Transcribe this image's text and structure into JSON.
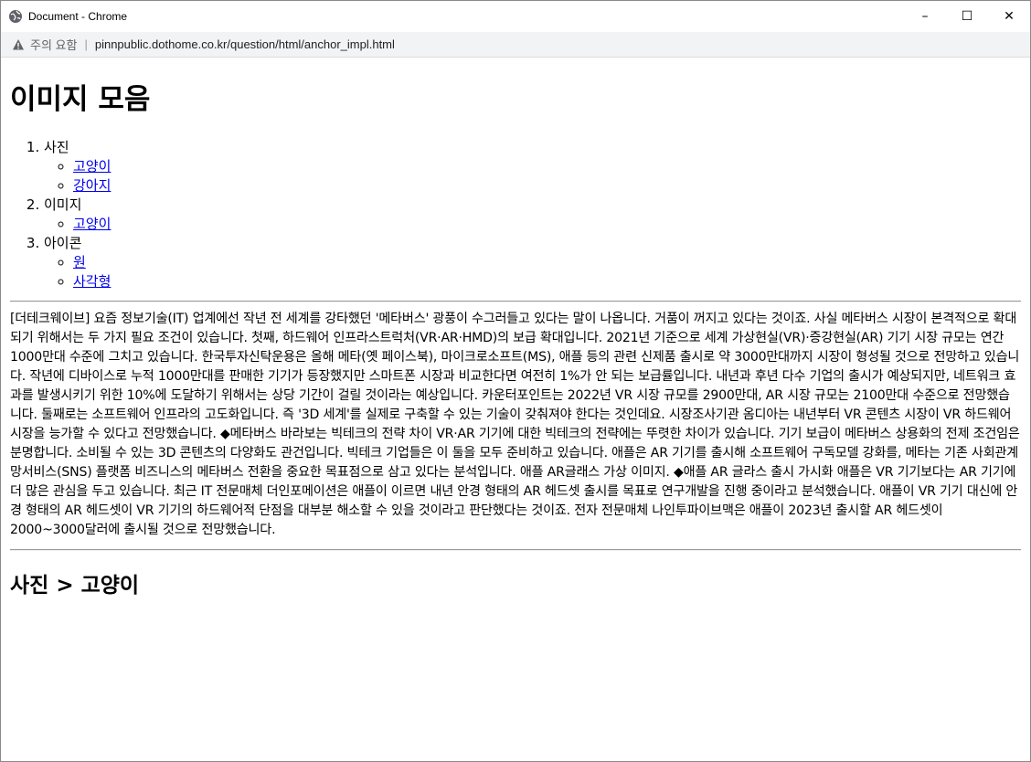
{
  "window": {
    "title": "Document - Chrome",
    "minimize_glyph": "–",
    "maximize_glyph": "☐",
    "close_glyph": "✕"
  },
  "addressbar": {
    "warning_text": "주의 요함",
    "separator": "|",
    "url": "pinnpublic.dothome.co.kr/question/html/anchor_impl.html"
  },
  "page": {
    "heading": "이미지 모음",
    "toc": [
      {
        "label": "사진",
        "links": [
          "고양이",
          "강아지"
        ]
      },
      {
        "label": "이미지",
        "links": [
          "고양이"
        ]
      },
      {
        "label": "아이콘",
        "links": [
          "원",
          "사각형"
        ]
      }
    ],
    "article": "[더테크웨이브] 요즘 정보기술(IT) 업계에선 작년 전 세계를 강타했던 '메타버스' 광풍이 수그러들고 있다는 말이 나옵니다. 거품이 꺼지고 있다는 것이죠. 사실 메타버스 시장이 본격적으로 확대되기 위해서는 두 가지 필요 조건이 있습니다. 첫째, 하드웨어 인프라스트럭처(VR·AR·HMD)의 보급 확대입니다. 2021년 기준으로 세계 가상현실(VR)·증강현실(AR) 기기 시장 규모는 연간 1000만대 수준에 그치고 있습니다. 한국투자신탁운용은 올해 메타(옛 페이스북), 마이크로소프트(MS), 애플 등의 관련 신제품 출시로 약 3000만대까지 시장이 형성될 것으로 전망하고 있습니다. 작년에 디바이스로 누적 1000만대를 판매한 기기가 등장했지만 스마트폰 시장과 비교한다면 여전히 1%가 안 되는 보급률입니다. 내년과 후년 다수 기업의 출시가 예상되지만, 네트워크 효과를 발생시키기 위한 10%에 도달하기 위해서는 상당 기간이 걸릴 것이라는 예상입니다. 카운터포인트는 2022년 VR 시장 규모를 2900만대, AR 시장 규모는 2100만대 수준으로 전망했습니다. 둘째로는 소프트웨어 인프라의 고도화입니다. 즉 '3D 세계'를 실제로 구축할 수 있는 기술이 갖춰져야 한다는 것인데요. 시장조사기관 옴디아는 내년부터 VR 콘텐츠 시장이 VR 하드웨어 시장을 능가할 수 있다고 전망했습니다. ◆메타버스 바라보는 빅테크의 전략 차이 VR·AR 기기에 대한 빅테크의 전략에는 뚜렷한 차이가 있습니다. 기기 보급이 메타버스 상용화의 전제 조건임은 분명합니다. 소비될 수 있는 3D 콘텐츠의 다양화도 관건입니다. 빅테크 기업들은 이 둘을 모두 준비하고 있습니다. 애플은 AR 기기를 출시해 소프트웨어 구독모델 강화를, 메타는 기존 사회관계망서비스(SNS) 플랫폼 비즈니스의 메타버스 전환을 중요한 목표점으로 삼고 있다는 분석입니다. 애플 AR글래스 가상 이미지. ◆애플 AR 글라스 출시 가시화 애플은 VR 기기보다는 AR 기기에 더 많은 관심을 두고 있습니다. 최근 IT 전문매체 더인포메이션은 애플이 이르면 내년 안경 형태의 AR 헤드셋 출시를 목표로 연구개발을 진행 중이라고 분석했습니다. 애플이 VR 기기 대신에 안경 형태의 AR 헤드셋이 VR 기기의 하드웨어적 단점을 대부분 해소할 수 있을 것이라고 판단했다는 것이죠. 전자 전문매체 나인투파이브맥은 애플이 2023년 출시할 AR 헤드셋이 2000~3000달러에 출시될 것으로 전망했습니다.",
    "section_heading": "사진 > 고양이"
  }
}
